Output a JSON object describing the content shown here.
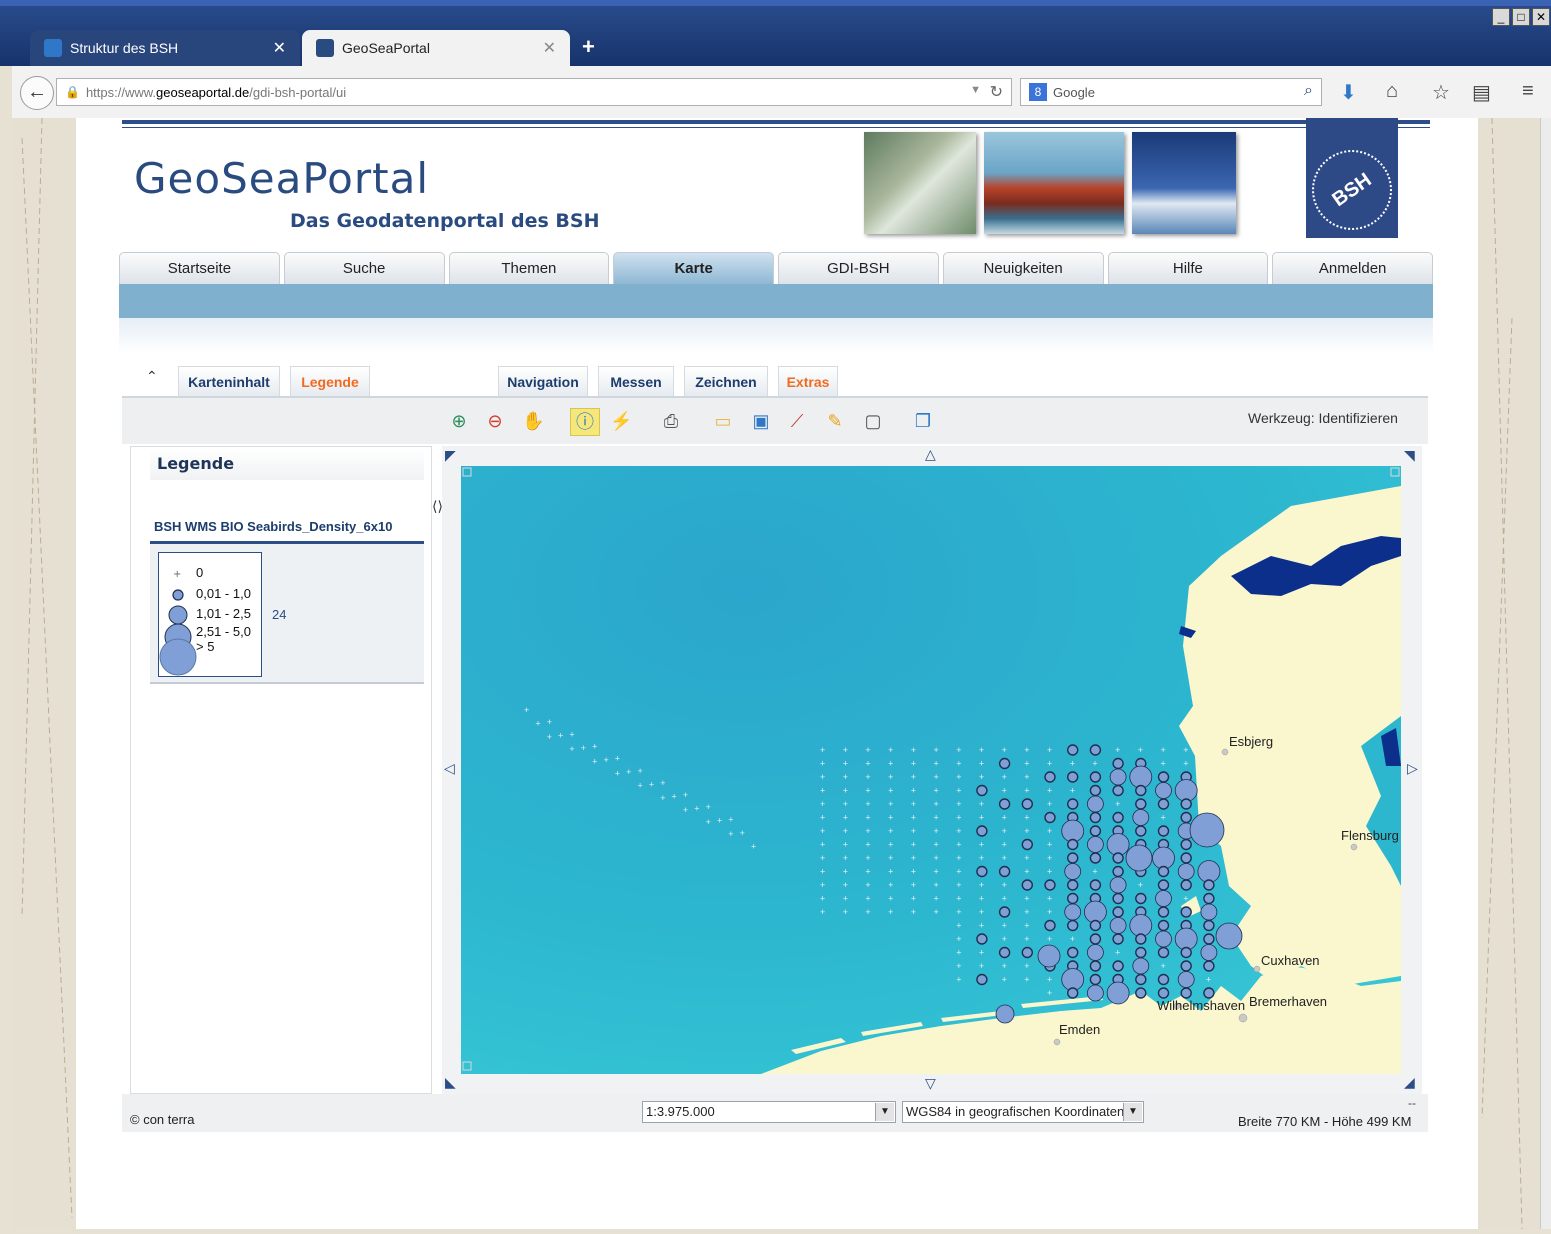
{
  "browser": {
    "tabs": [
      {
        "label": "Struktur des BSH"
      },
      {
        "label": "GeoSeaPortal"
      }
    ],
    "url_prefix": "https://www.",
    "url_domain": "geoseaportal.de",
    "url_path": "/gdi-bsh-portal/ui",
    "search_placeholder": "Google"
  },
  "header": {
    "title": "GeoSeaPortal",
    "subtitle": "Das Geodatenportal des BSH",
    "logo_text": "BSH"
  },
  "menu": [
    {
      "label": "Startseite"
    },
    {
      "label": "Suche"
    },
    {
      "label": "Themen"
    },
    {
      "label": "Karte"
    },
    {
      "label": "GDI-BSH"
    },
    {
      "label": "Neuigkeiten"
    },
    {
      "label": "Hilfe"
    },
    {
      "label": "Anmelden"
    }
  ],
  "panel_tabs": [
    {
      "label": "Karteninhalt"
    },
    {
      "label": "Legende"
    },
    {
      "label": "Navigation"
    },
    {
      "label": "Messen"
    },
    {
      "label": "Zeichnen"
    },
    {
      "label": "Extras"
    }
  ],
  "toolbar": {
    "status": "Werkzeug: Identifizieren"
  },
  "legend": {
    "title": "Legende",
    "layer_name": "BSH WMS BIO Seabirds_Density_6x10",
    "classes": [
      "0",
      "0,01 - 1,0",
      "1,01 - 2,5",
      "2,51 - 5,0",
      "> 5"
    ],
    "layer_number": "24"
  },
  "map": {
    "labels": [
      "Esbjerg",
      "Flensburg",
      "Cuxhaven",
      "Wilhelmshaven",
      "Bremerhaven",
      "Emden"
    ]
  },
  "status": {
    "copyright": "© con terra",
    "scale": "1:3.975.000",
    "crs": "WGS84 in geografischen Koordinaten",
    "extent": "Breite 770 KM - Höhe 499 KM",
    "dash": "--"
  },
  "colors": {
    "brand_blue": "#2a4b80",
    "accent_orange": "#f26a21",
    "sea": "#2cb3cd",
    "land": "#faf7cf",
    "bird_symbol": "#7f9fd6"
  }
}
